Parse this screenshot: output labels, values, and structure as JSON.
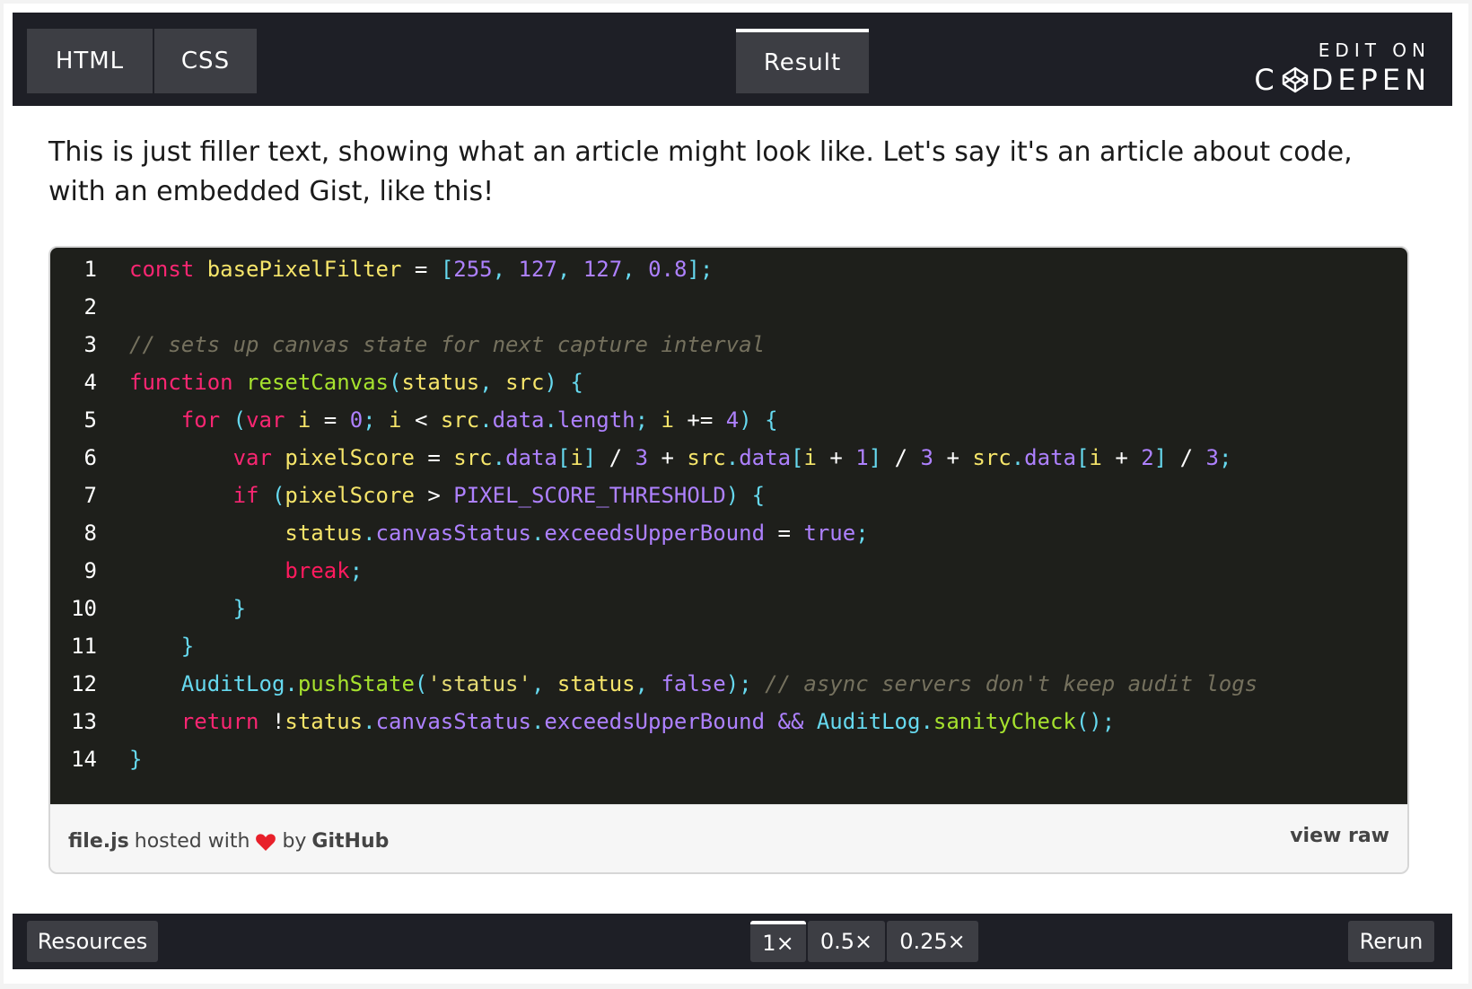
{
  "topbar": {
    "tabs": [
      {
        "label": "HTML"
      },
      {
        "label": "CSS"
      },
      {
        "label": "Result"
      }
    ],
    "edit_on": "EDIT ON",
    "codepen_pre": "C",
    "codepen_post": "DEPEN"
  },
  "article": {
    "text": "This is just filler text, showing what an article might look like. Let's say it's an article about code, with an embedded Gist, like this!"
  },
  "gist": {
    "line_numbers": [
      "1",
      "2",
      "3",
      "4",
      "5",
      "6",
      "7",
      "8",
      "9",
      "10",
      "11",
      "12",
      "13",
      "14"
    ],
    "code": [
      [
        [
          "k",
          "const"
        ],
        [
          "op",
          " "
        ],
        [
          "id",
          "basePixelFilter"
        ],
        [
          "op",
          " = "
        ],
        [
          "pu",
          "["
        ],
        [
          "num",
          "255"
        ],
        [
          "pu",
          ", "
        ],
        [
          "num",
          "127"
        ],
        [
          "pu",
          ", "
        ],
        [
          "num",
          "127"
        ],
        [
          "pu",
          ", "
        ],
        [
          "num",
          "0.8"
        ],
        [
          "pu",
          "];"
        ]
      ],
      [],
      [
        [
          "cm",
          "// sets up canvas state for next capture interval"
        ]
      ],
      [
        [
          "k",
          "function"
        ],
        [
          "op",
          " "
        ],
        [
          "fn",
          "resetCanvas"
        ],
        [
          "pu",
          "("
        ],
        [
          "id",
          "status"
        ],
        [
          "pu",
          ", "
        ],
        [
          "id",
          "src"
        ],
        [
          "pu",
          ") {"
        ]
      ],
      [
        [
          "op",
          "    "
        ],
        [
          "k",
          "for"
        ],
        [
          "op",
          " "
        ],
        [
          "pu",
          "("
        ],
        [
          "k",
          "var"
        ],
        [
          "op",
          " "
        ],
        [
          "id",
          "i"
        ],
        [
          "op",
          " = "
        ],
        [
          "num",
          "0"
        ],
        [
          "pu",
          "; "
        ],
        [
          "id",
          "i"
        ],
        [
          "op",
          " < "
        ],
        [
          "id",
          "src"
        ],
        [
          "pu",
          "."
        ],
        [
          "pr",
          "data"
        ],
        [
          "pu",
          "."
        ],
        [
          "pr",
          "length"
        ],
        [
          "pu",
          "; "
        ],
        [
          "id",
          "i"
        ],
        [
          "op",
          " += "
        ],
        [
          "num",
          "4"
        ],
        [
          "pu",
          ") {"
        ]
      ],
      [
        [
          "op",
          "        "
        ],
        [
          "k",
          "var"
        ],
        [
          "op",
          " "
        ],
        [
          "id",
          "pixelScore"
        ],
        [
          "op",
          " = "
        ],
        [
          "id",
          "src"
        ],
        [
          "pu",
          "."
        ],
        [
          "pr",
          "data"
        ],
        [
          "pu",
          "["
        ],
        [
          "id",
          "i"
        ],
        [
          "pu",
          "]"
        ],
        [
          "op",
          " / "
        ],
        [
          "num",
          "3"
        ],
        [
          "op",
          " + "
        ],
        [
          "id",
          "src"
        ],
        [
          "pu",
          "."
        ],
        [
          "pr",
          "data"
        ],
        [
          "pu",
          "["
        ],
        [
          "id",
          "i"
        ],
        [
          "op",
          " + "
        ],
        [
          "num",
          "1"
        ],
        [
          "pu",
          "]"
        ],
        [
          "op",
          " / "
        ],
        [
          "num",
          "3"
        ],
        [
          "op",
          " + "
        ],
        [
          "id",
          "src"
        ],
        [
          "pu",
          "."
        ],
        [
          "pr",
          "data"
        ],
        [
          "pu",
          "["
        ],
        [
          "id",
          "i"
        ],
        [
          "op",
          " + "
        ],
        [
          "num",
          "2"
        ],
        [
          "pu",
          "]"
        ],
        [
          "op",
          " / "
        ],
        [
          "num",
          "3"
        ],
        [
          "pu",
          ";"
        ]
      ],
      [
        [
          "op",
          "        "
        ],
        [
          "k",
          "if"
        ],
        [
          "op",
          " "
        ],
        [
          "pu",
          "("
        ],
        [
          "id",
          "pixelScore"
        ],
        [
          "op",
          " > "
        ],
        [
          "cn",
          "PIXEL_SCORE_THRESHOLD"
        ],
        [
          "pu",
          ") {"
        ]
      ],
      [
        [
          "op",
          "            "
        ],
        [
          "id",
          "status"
        ],
        [
          "pu",
          "."
        ],
        [
          "pr",
          "canvasStatus"
        ],
        [
          "pu",
          "."
        ],
        [
          "pr",
          "exceedsUpperBound"
        ],
        [
          "op",
          " = "
        ],
        [
          "cn",
          "true"
        ],
        [
          "pu",
          ";"
        ]
      ],
      [
        [
          "op",
          "            "
        ],
        [
          "kw",
          "break"
        ],
        [
          "pu",
          ";"
        ]
      ],
      [
        [
          "op",
          "        "
        ],
        [
          "pu",
          "}"
        ]
      ],
      [
        [
          "op",
          "    "
        ],
        [
          "pu",
          "}"
        ]
      ],
      [
        [
          "op",
          "    "
        ],
        [
          "ob",
          "AuditLog"
        ],
        [
          "pu",
          "."
        ],
        [
          "fn",
          "pushState"
        ],
        [
          "pu",
          "("
        ],
        [
          "st",
          "'status'"
        ],
        [
          "pu",
          ", "
        ],
        [
          "id",
          "status"
        ],
        [
          "pu",
          ", "
        ],
        [
          "cn",
          "false"
        ],
        [
          "pu",
          ");"
        ],
        [
          "op",
          " "
        ],
        [
          "cm",
          "// async servers don't keep audit logs"
        ]
      ],
      [
        [
          "op",
          "    "
        ],
        [
          "k",
          "return"
        ],
        [
          "op",
          " !"
        ],
        [
          "id",
          "status"
        ],
        [
          "pu",
          "."
        ],
        [
          "pr",
          "canvasStatus"
        ],
        [
          "pu",
          "."
        ],
        [
          "pr",
          "exceedsUpperBound"
        ],
        [
          "op",
          " "
        ],
        [
          "pr",
          "&&"
        ],
        [
          "op",
          " "
        ],
        [
          "ob",
          "AuditLog"
        ],
        [
          "pu",
          "."
        ],
        [
          "fn",
          "sanityCheck"
        ],
        [
          "pu",
          "();"
        ]
      ],
      [
        [
          "pu",
          "}"
        ]
      ]
    ],
    "footer": {
      "filename": "file.js",
      "hosted_with": "hosted with",
      "by": "by",
      "github": "GitHub",
      "view_raw": "view raw"
    }
  },
  "bottombar": {
    "resources": "Resources",
    "zoom_options": [
      "1×",
      "0.5×",
      "0.25×"
    ],
    "zoom_selected": "1×",
    "rerun": "Rerun"
  },
  "colors": {
    "bar_bg": "#1e1f26",
    "button_bg": "#3d3e44",
    "code_bg": "#1e1f1b",
    "heart": "#e8202a"
  }
}
